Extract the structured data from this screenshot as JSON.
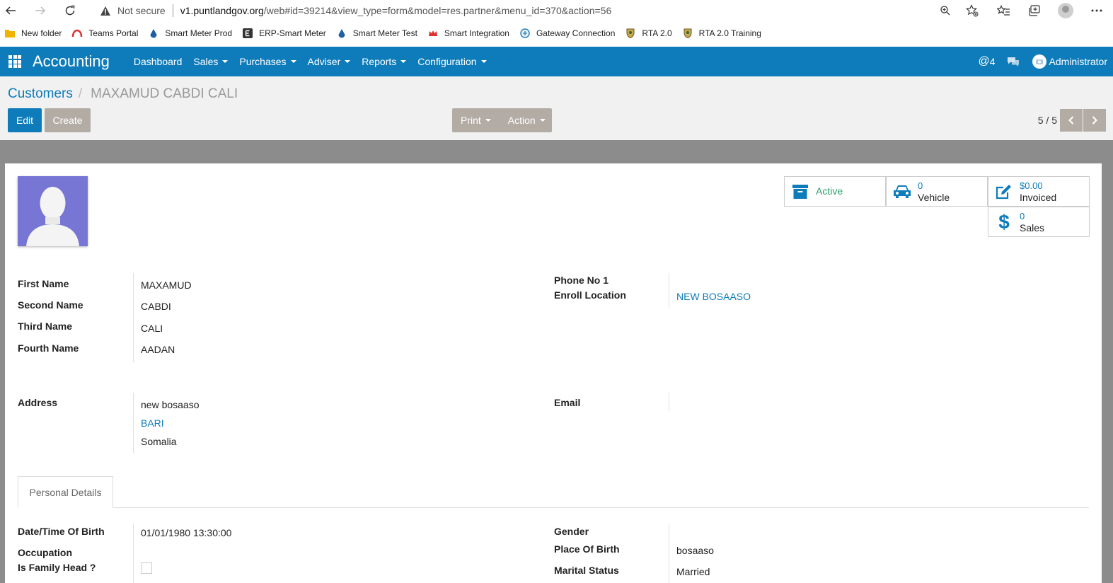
{
  "browser": {
    "security_label": "Not secure",
    "url_host": "v1.puntlandgov.org",
    "url_path": "/web#id=39214&view_type=form&model=res.partner&menu_id=370&action=56"
  },
  "bookmarks": [
    {
      "label": "New folder",
      "icon": "folder-icon",
      "color": "#f0b400"
    },
    {
      "label": "Teams Portal",
      "icon": "teams-portal-icon",
      "color": "#d33"
    },
    {
      "label": "Smart Meter Prod",
      "icon": "water-drop-icon",
      "color": "#1f5fa8"
    },
    {
      "label": "ERP-Smart Meter",
      "icon": "erp-e-icon",
      "color": "#333"
    },
    {
      "label": "Smart Meter Test",
      "icon": "water-drop-icon",
      "color": "#1f5fa8"
    },
    {
      "label": "Smart Integration",
      "icon": "crown-icon",
      "color": "#d33"
    },
    {
      "label": "Gateway Connection",
      "icon": "gateway-icon",
      "color": "#2a7fb8"
    },
    {
      "label": "RTA 2.0",
      "icon": "emblem-icon",
      "color": "#8a6d2d"
    },
    {
      "label": "RTA 2.0 Training",
      "icon": "emblem-icon",
      "color": "#8a6d2d"
    }
  ],
  "nav": {
    "app_name": "Accounting",
    "menu": [
      {
        "label": "Dashboard",
        "dropdown": false
      },
      {
        "label": "Sales",
        "dropdown": true
      },
      {
        "label": "Purchases",
        "dropdown": true
      },
      {
        "label": "Adviser",
        "dropdown": true
      },
      {
        "label": "Reports",
        "dropdown": true
      },
      {
        "label": "Configuration",
        "dropdown": true
      }
    ],
    "mention_count": "4",
    "user": "Administrator"
  },
  "control": {
    "breadcrumb_parent": "Customers",
    "breadcrumb_current": "MAXAMUD CABDI CALI",
    "edit_label": "Edit",
    "create_label": "Create",
    "print_label": "Print",
    "action_label": "Action",
    "pager": "5 / 5"
  },
  "smart_buttons": {
    "active": {
      "label": "Active"
    },
    "vehicle": {
      "value": "0",
      "label": "Vehicle"
    },
    "invoiced": {
      "value": "$0.00",
      "label": "Invoiced"
    },
    "sales": {
      "value": "0",
      "label": "Sales"
    }
  },
  "names": {
    "first_label": "First Name",
    "first_value": "MAXAMUD",
    "second_label": "Second Name",
    "second_value": "CABDI",
    "third_label": "Third Name",
    "third_value": "CALI",
    "fourth_label": "Fourth Name",
    "fourth_value": "AADAN"
  },
  "contact": {
    "phone_label": "Phone No 1",
    "enroll_label": "Enroll Location",
    "enroll_value": "NEW BOSAASO",
    "email_label": "Email"
  },
  "address": {
    "label": "Address",
    "street": "new bosaaso",
    "region": "BARI",
    "country": "Somalia"
  },
  "tabs": {
    "personal": "Personal Details"
  },
  "personal": {
    "dob_label": "Date/Time Of Birth",
    "dob_value": "01/01/1980 13:30:00",
    "occupation_label": "Occupation",
    "family_head_label": "Is Family Head ?",
    "gender_label": "Gender",
    "birthplace_label": "Place Of Birth",
    "birthplace_value": "bosaaso",
    "marital_label": "Marital Status",
    "marital_value": "Married"
  },
  "colors": {
    "brand": "#0e7cba",
    "secondary_button": "#b3aca5",
    "active_green": "#2a9d6a",
    "avatar_bg": "#7776d4"
  }
}
